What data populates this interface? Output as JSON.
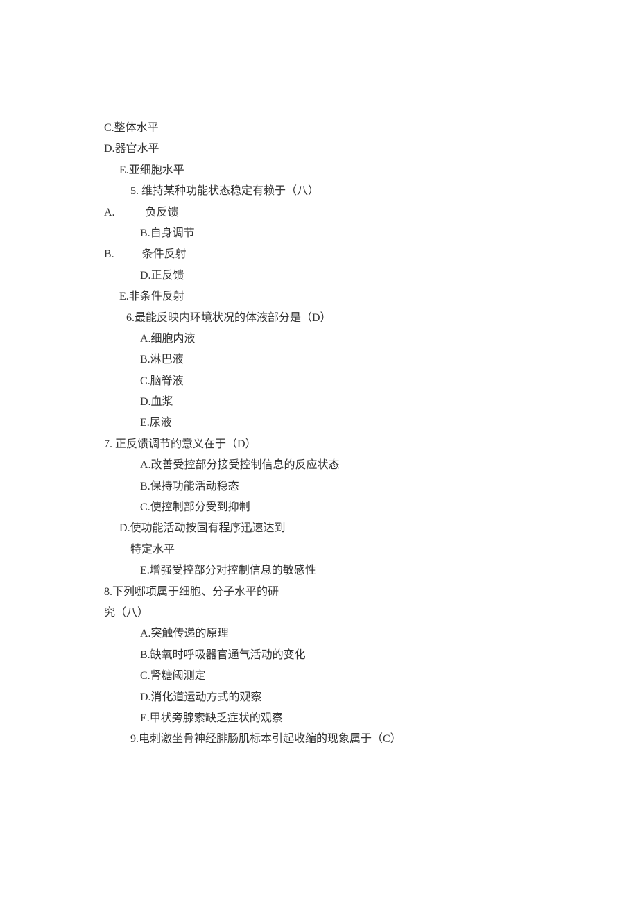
{
  "lines": [
    {
      "indent": "i0",
      "text": "C.整体水平"
    },
    {
      "indent": "i0",
      "text": "D.器官水平"
    },
    {
      "indent": "i1",
      "text": "E.亚细胞水平"
    },
    {
      "indent": "i2",
      "text": "5. 维持某种功能状态稳定有赖于（八）"
    },
    {
      "indent": "i0",
      "text": "A.           负反馈"
    },
    {
      "indent": "i4",
      "text": "B.自身调节"
    },
    {
      "indent": "i0",
      "text": "B.          条件反射"
    },
    {
      "indent": "i4",
      "text": "D.正反馈"
    },
    {
      "indent": "i1",
      "text": "E.非条件反射"
    },
    {
      "indent": "i6",
      "text": " 6.最能反映内环境状况的体液部分是（D）"
    },
    {
      "indent": "i4",
      "text": "A.细胞内液"
    },
    {
      "indent": "i4",
      "text": "B.淋巴液"
    },
    {
      "indent": "i4",
      "text": "C.脑脊液"
    },
    {
      "indent": "i4",
      "text": "D.血浆"
    },
    {
      "indent": "i4",
      "text": "E.尿液"
    },
    {
      "indent": "i0",
      "text": "7. 正反馈调节的意义在于（D）"
    },
    {
      "indent": "i4",
      "text": "A.改善受控部分接受控制信息的反应状态"
    },
    {
      "indent": "i4",
      "text": "B.保持功能活动稳态"
    },
    {
      "indent": "i4",
      "text": "C.使控制部分受到抑制"
    },
    {
      "indent": "i1",
      "text": "D.使功能活动按固有程序迅速达到"
    },
    {
      "indent": "i2",
      "text": "特定水平"
    },
    {
      "indent": "i4",
      "text": "E.增强受控部分对控制信息的敏感性"
    },
    {
      "indent": "i0",
      "text": "8.下列哪项属于细胞、分子水平的研"
    },
    {
      "indent": "i0",
      "text": "究（八）"
    },
    {
      "indent": "i4",
      "text": "A.突触传递的原理"
    },
    {
      "indent": "i4",
      "text": "B.缺氧时呼吸器官通气活动的变化"
    },
    {
      "indent": "i4",
      "text": "C.肾糖阈测定"
    },
    {
      "indent": "i4",
      "text": "D.消化道运动方式的观察"
    },
    {
      "indent": "i4",
      "text": "E.甲状旁腺索缺乏症状的观察"
    },
    {
      "indent": "i2",
      "text": "9.电刺激坐骨神经腓肠肌标本引起收缩的现象属于（C）"
    }
  ]
}
